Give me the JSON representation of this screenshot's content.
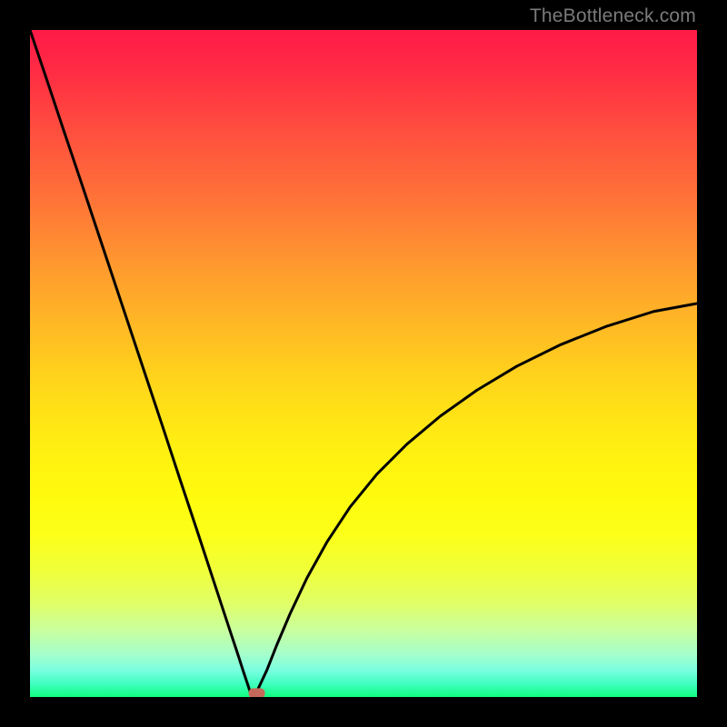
{
  "watermark": "TheBottleneck.com",
  "chart_data": {
    "type": "line",
    "title": "",
    "xlabel": "",
    "ylabel": "",
    "xlim": [
      0,
      1
    ],
    "ylim": [
      0,
      1
    ],
    "notch_x": 0.333,
    "left_edge_y": 1.0,
    "right_edge_y": 0.59,
    "marker": {
      "x": 0.34,
      "y": 0.005
    },
    "series": [
      {
        "name": "bottleneck-curve",
        "x": [
          0.0,
          0.025,
          0.05,
          0.075,
          0.1,
          0.125,
          0.15,
          0.175,
          0.2,
          0.225,
          0.25,
          0.275,
          0.3,
          0.31,
          0.32,
          0.33,
          0.333,
          0.34,
          0.355,
          0.37,
          0.39,
          0.415,
          0.445,
          0.48,
          0.52,
          0.565,
          0.615,
          0.67,
          0.73,
          0.795,
          0.865,
          0.935,
          1.0
        ],
        "y": [
          1.0,
          0.926,
          0.851,
          0.777,
          0.702,
          0.627,
          0.552,
          0.477,
          0.402,
          0.326,
          0.251,
          0.175,
          0.099,
          0.069,
          0.038,
          0.008,
          0.003,
          0.008,
          0.04,
          0.078,
          0.125,
          0.178,
          0.232,
          0.285,
          0.334,
          0.379,
          0.421,
          0.46,
          0.496,
          0.528,
          0.556,
          0.578,
          0.59
        ]
      }
    ],
    "background_gradient": {
      "top": "#ff1a48",
      "mid": "#ffee12",
      "bottom": "#11fd7f"
    }
  }
}
